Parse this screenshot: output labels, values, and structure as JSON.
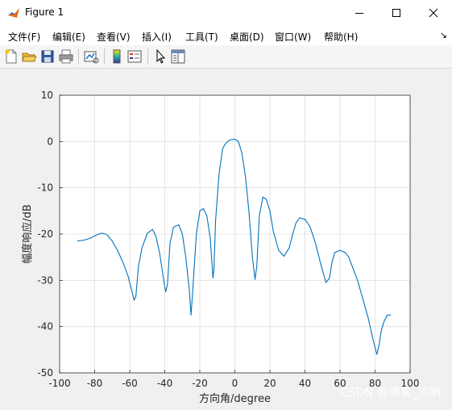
{
  "window": {
    "title": "Figure 1"
  },
  "menu": {
    "items": [
      {
        "label": "文件(F)"
      },
      {
        "label": "编辑(E)"
      },
      {
        "label": "查看(V)"
      },
      {
        "label": "插入(I)"
      },
      {
        "label": "工具(T)"
      },
      {
        "label": "桌面(D)"
      },
      {
        "label": "窗口(W)"
      },
      {
        "label": "帮助(H)"
      }
    ],
    "overflow_icon": "dock-arrow-icon"
  },
  "toolbar": {
    "icons": [
      "new-figure-icon",
      "open-file-icon",
      "save-icon",
      "print-icon",
      "link-plot-icon",
      "insert-colorbar-icon",
      "insert-legend-icon",
      "edit-plot-icon",
      "property-inspector-icon"
    ]
  },
  "colors": {
    "line": "#0072bd",
    "grid": "#dfdfdf",
    "axes_bg": "#ffffff",
    "window_bg": "#f0f0f0"
  },
  "chart_data": {
    "type": "line",
    "title": "",
    "xlabel": "方向角/degree",
    "ylabel": "幅度响应/dB",
    "xlim": [
      -100,
      100
    ],
    "ylim": [
      -50,
      10
    ],
    "xticks": [
      "-100",
      "-80",
      "-60",
      "-40",
      "-20",
      "0",
      "20",
      "40",
      "60",
      "80",
      "100"
    ],
    "yticks": [
      "10",
      "0",
      "-10",
      "-20",
      "-30",
      "-40",
      "-50"
    ],
    "grid": true,
    "series": [
      {
        "x": [
          -90,
          -86,
          -82,
          -79,
          -76,
          -73,
          -70,
          -67,
          -64,
          -61,
          -59,
          -57.5,
          -56.5,
          -55,
          -53,
          -50,
          -47,
          -45,
          -43,
          -41,
          -39.5,
          -38.5,
          -37,
          -35,
          -32,
          -30,
          -28,
          -26,
          -25,
          -24,
          -22,
          -20,
          -18,
          -16,
          -14,
          -12.5,
          -12,
          -11,
          -9,
          -7,
          -5,
          -3,
          -1,
          0,
          2,
          4,
          6,
          8,
          10,
          11.5,
          12.5,
          14,
          16,
          18,
          20,
          22,
          25,
          28,
          31,
          33,
          35,
          37,
          40,
          43,
          46,
          49,
          52,
          54,
          55.5,
          57,
          60,
          63,
          65,
          67,
          70,
          73,
          76,
          79,
          81,
          82.3,
          83.5,
          85,
          87,
          89
        ],
        "y": [
          -21.5,
          -21.3,
          -20.8,
          -20.2,
          -19.8,
          -20.1,
          -21.5,
          -23.5,
          -26,
          -29,
          -32,
          -34.3,
          -33.5,
          -27,
          -23,
          -19.8,
          -19,
          -20.5,
          -24,
          -29,
          -32.5,
          -31,
          -22,
          -18.5,
          -18,
          -20,
          -25,
          -32,
          -37.5,
          -32,
          -20,
          -15,
          -14.5,
          -16,
          -21,
          -29.5,
          -28,
          -17,
          -7,
          -1.5,
          -0.3,
          0.3,
          0.5,
          0.5,
          0,
          -2.5,
          -7.5,
          -15,
          -25,
          -29.8,
          -27,
          -16,
          -12,
          -12.5,
          -15,
          -19.5,
          -23.5,
          -24.8,
          -23,
          -20,
          -17.5,
          -16.5,
          -16.8,
          -18.5,
          -22,
          -26.5,
          -30.5,
          -29.5,
          -26,
          -24,
          -23.5,
          -24,
          -25,
          -27,
          -30,
          -34,
          -38,
          -43,
          -46,
          -44,
          -41,
          -39,
          -37.5,
          -37.5
        ]
      }
    ]
  },
  "watermark": "CSDN @清泉_流响"
}
